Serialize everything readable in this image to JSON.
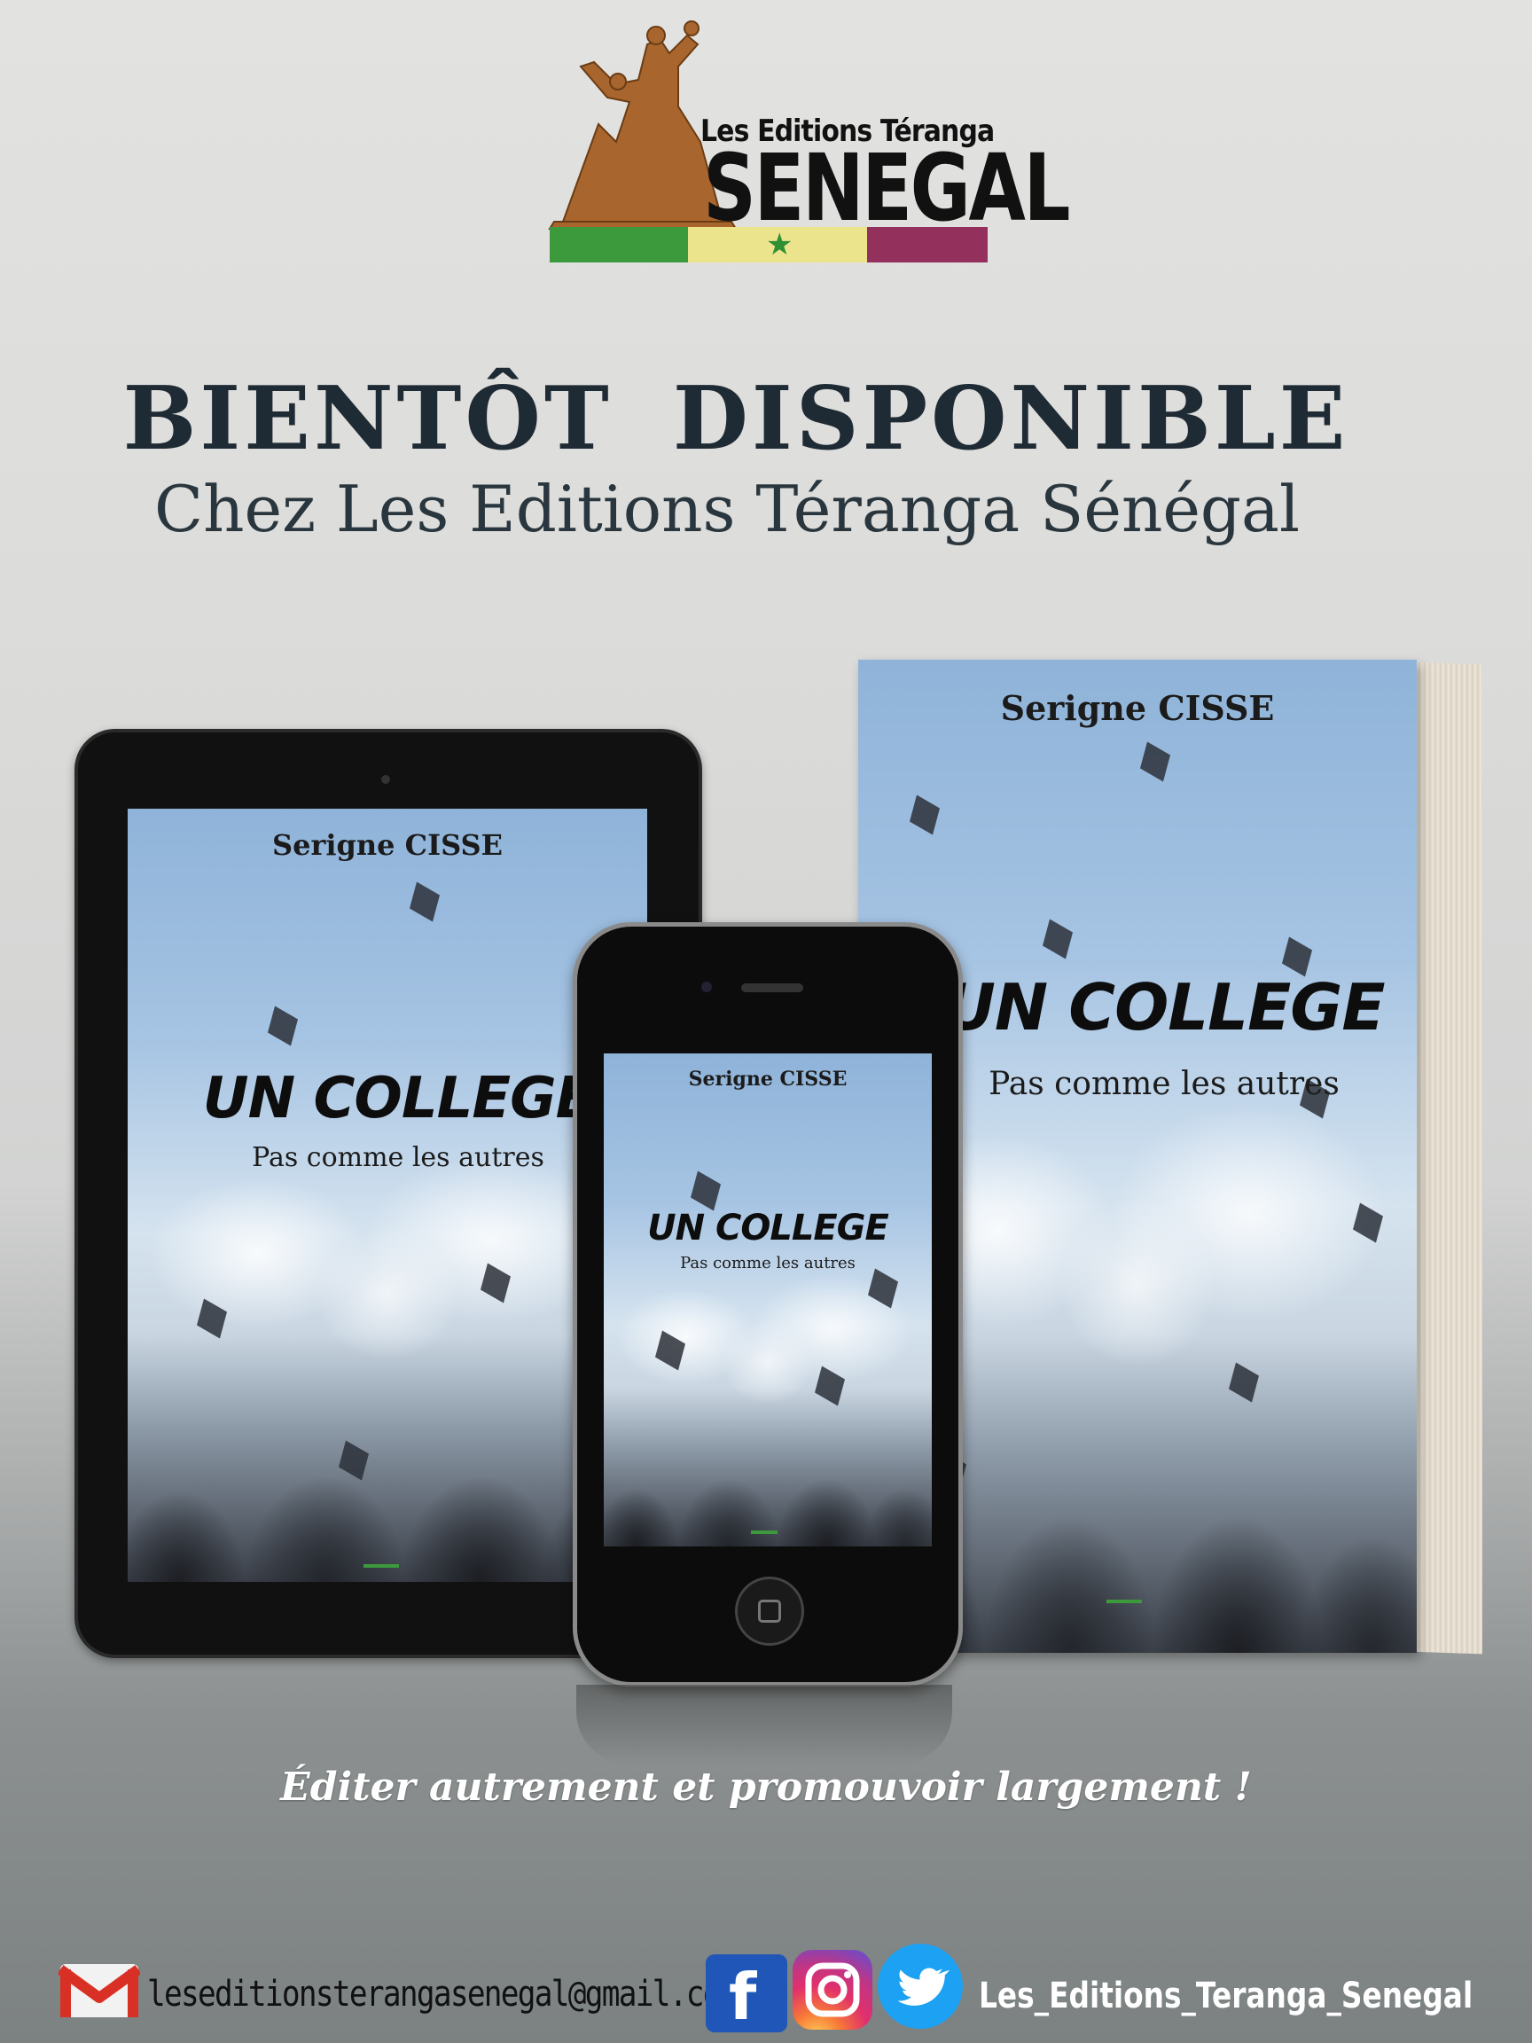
{
  "publisher": {
    "logo_line1": "Les Editions Téranga",
    "logo_line2": "SENEGAL",
    "flag_colors": [
      "#3d9a3c",
      "#ece48c",
      "#93305c"
    ]
  },
  "headline": "BIENTÔT  DISPONIBLE",
  "subheadline": "Chez Les Editions Téranga Sénégal",
  "book": {
    "author": "Serigne CISSE",
    "title": "UN COLLEGE",
    "subtitle": "Pas comme les autres"
  },
  "slogan": "Éditer autrement et  promouvoir largement !",
  "footer": {
    "email": "leseditionsterangasenegal@gmail.com",
    "social_handle": "Les_Editions_Teranga_Senegal",
    "icons": [
      "gmail-icon",
      "facebook-icon",
      "instagram-icon",
      "twitter-icon"
    ]
  }
}
